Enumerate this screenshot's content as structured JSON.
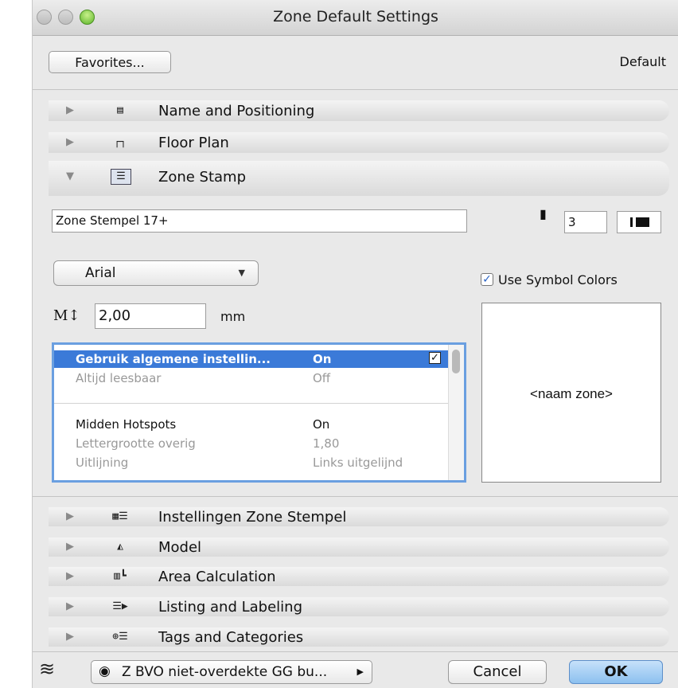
{
  "window": {
    "title": "Zone Default Settings"
  },
  "header": {
    "favorites_label": "Favorites...",
    "default_label": "Default"
  },
  "sections": {
    "name_positioning": "Name and Positioning",
    "floor_plan": "Floor Plan",
    "zone_stamp": "Zone Stamp",
    "instellingen": "Instellingen Zone Stempel",
    "model": "Model",
    "area_calculation": "Area Calculation",
    "listing_labeling": "Listing and Labeling",
    "tags_categories": "Tags and Categories"
  },
  "zone_stamp": {
    "stamp_name": "Zone Stempel 17+",
    "pen_number": "3",
    "font": "Arial",
    "size_value": "2,00",
    "size_unit": "mm",
    "use_symbol_colors_label": "Use Symbol Colors",
    "use_symbol_colors_checked": true,
    "preview_text": "<naam zone>",
    "params": [
      {
        "name": "Gebruik algemene instellin...",
        "value": "On",
        "checked": true,
        "selected": true
      },
      {
        "name": "Altijd leesbaar",
        "value": "Off",
        "disabled": true
      },
      {
        "name": "Midden Hotspots",
        "value": "On"
      },
      {
        "name": "Lettergrootte overig",
        "value": "1,80",
        "disabled": true
      },
      {
        "name": "Uitlijning",
        "value": "Links uitgelijnd",
        "disabled": true
      }
    ]
  },
  "footer": {
    "layer_label": "Z BVO niet-overdekte GG bu...",
    "cancel_label": "Cancel",
    "ok_label": "OK"
  },
  "colors": {
    "selection": "#3b7ad8",
    "ok_button": "#8cc0ef",
    "focus_ring": "#6a9fe0"
  }
}
